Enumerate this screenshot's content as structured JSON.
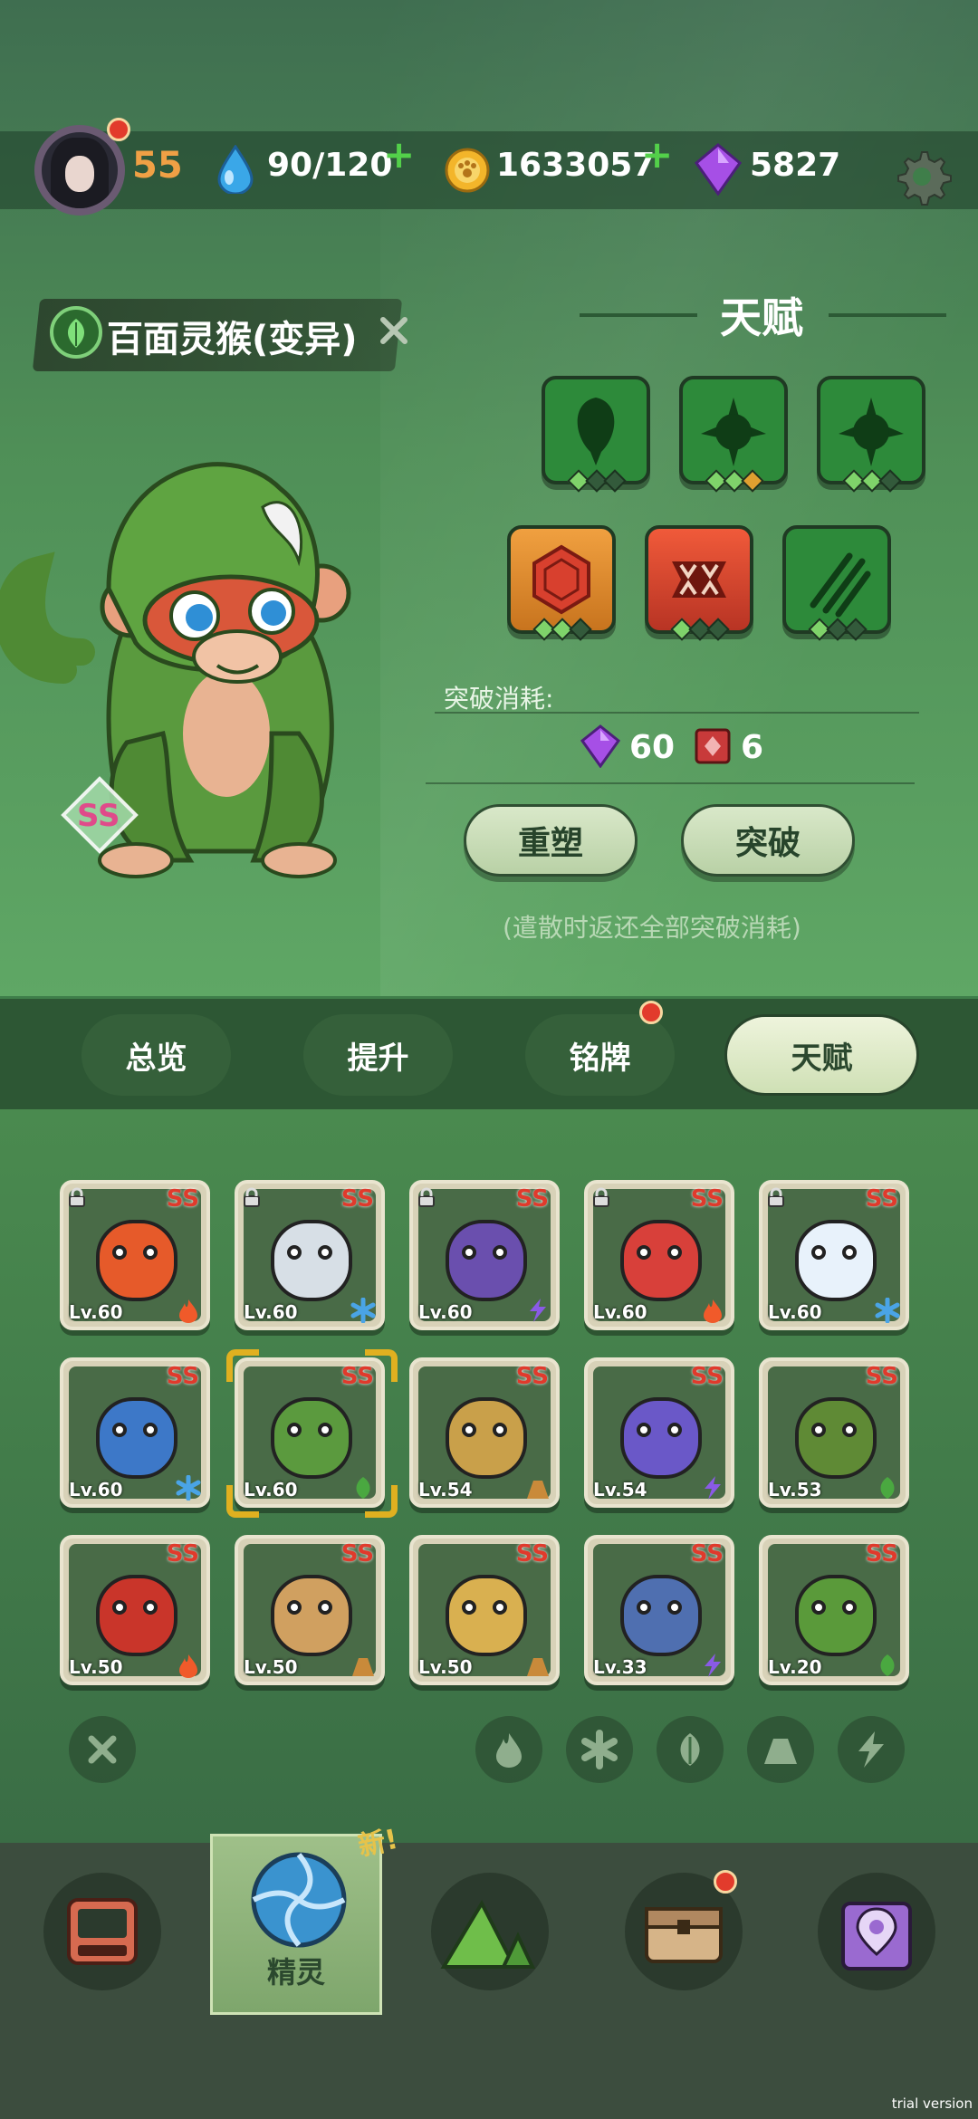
{
  "player": {
    "level": "55"
  },
  "resources": {
    "stamina": "90/120",
    "coins": "1633057",
    "gems": "5827"
  },
  "pet": {
    "name": "百面灵猴(变异)",
    "rank": "SS"
  },
  "talent": {
    "title": "天赋",
    "row1": [
      {
        "icon": "drop-shape-icon",
        "color": "#2d8a3a"
      },
      {
        "icon": "tri-spike-icon",
        "color": "#2d8a3a"
      },
      {
        "icon": "tri-spike-icon",
        "color": "#2d8a3a"
      }
    ],
    "row2": [
      {
        "icon": "hexagon-gem-icon",
        "color": "#d08a2a"
      },
      {
        "icon": "fang-mouth-icon",
        "color": "#c9443a"
      },
      {
        "icon": "claw-slash-icon",
        "color": "#2d8a3a"
      }
    ],
    "cost_label": "突破消耗:",
    "cost_gems": "60",
    "cost_books": "6",
    "reshape_label": "重塑",
    "breakthrough_label": "突破",
    "note": "(遣散时返还全部突破消耗)"
  },
  "tabs": [
    {
      "label": "总览"
    },
    {
      "label": "提升"
    },
    {
      "label": "铭牌"
    },
    {
      "label": "天赋"
    }
  ],
  "creatures": [
    {
      "rank": "SS",
      "level": "Lv.60",
      "element": "fire",
      "color": "#e65a2a",
      "locked": true
    },
    {
      "rank": "SS",
      "level": "Lv.60",
      "element": "ice",
      "color": "#d7dfe6",
      "locked": true
    },
    {
      "rank": "SS",
      "level": "Lv.60",
      "element": "thunder",
      "color": "#6a4fae",
      "locked": true
    },
    {
      "rank": "SS",
      "level": "Lv.60",
      "element": "fire",
      "color": "#d8403a",
      "locked": true
    },
    {
      "rank": "SS",
      "level": "Lv.60",
      "element": "ice",
      "color": "#e8f2fb",
      "locked": true
    },
    {
      "rank": "SS",
      "level": "Lv.60",
      "element": "ice",
      "color": "#3d78c8",
      "locked": false
    },
    {
      "rank": "SS",
      "level": "Lv.60",
      "element": "grass",
      "color": "#5b9a3e",
      "locked": false
    },
    {
      "rank": "SS",
      "level": "Lv.54",
      "element": "earth",
      "color": "#c9a04a",
      "locked": false
    },
    {
      "rank": "SS",
      "level": "Lv.54",
      "element": "thunder",
      "color": "#6a58c8",
      "locked": false
    },
    {
      "rank": "SS",
      "level": "Lv.53",
      "element": "grass",
      "color": "#5f8a35",
      "locked": false
    },
    {
      "rank": "SS",
      "level": "Lv.50",
      "element": "fire",
      "color": "#c9352a",
      "locked": false
    },
    {
      "rank": "SS",
      "level": "Lv.50",
      "element": "earth",
      "color": "#d0a060",
      "locked": false
    },
    {
      "rank": "SS",
      "level": "Lv.50",
      "element": "earth",
      "color": "#d9b050",
      "locked": false
    },
    {
      "rank": "SS",
      "level": "Lv.33",
      "element": "thunder",
      "color": "#4f6fb0",
      "locked": false
    },
    {
      "rank": "SS",
      "level": "Lv.20",
      "element": "grass",
      "color": "#5a9a3a",
      "locked": false
    }
  ],
  "filters": [
    "close-icon",
    "fire-icon",
    "ice-icon",
    "grass-icon",
    "earth-icon",
    "thunder-icon"
  ],
  "bottom_nav": {
    "active_label": "精灵",
    "new_tag": "新!"
  },
  "watermark": "trial version"
}
